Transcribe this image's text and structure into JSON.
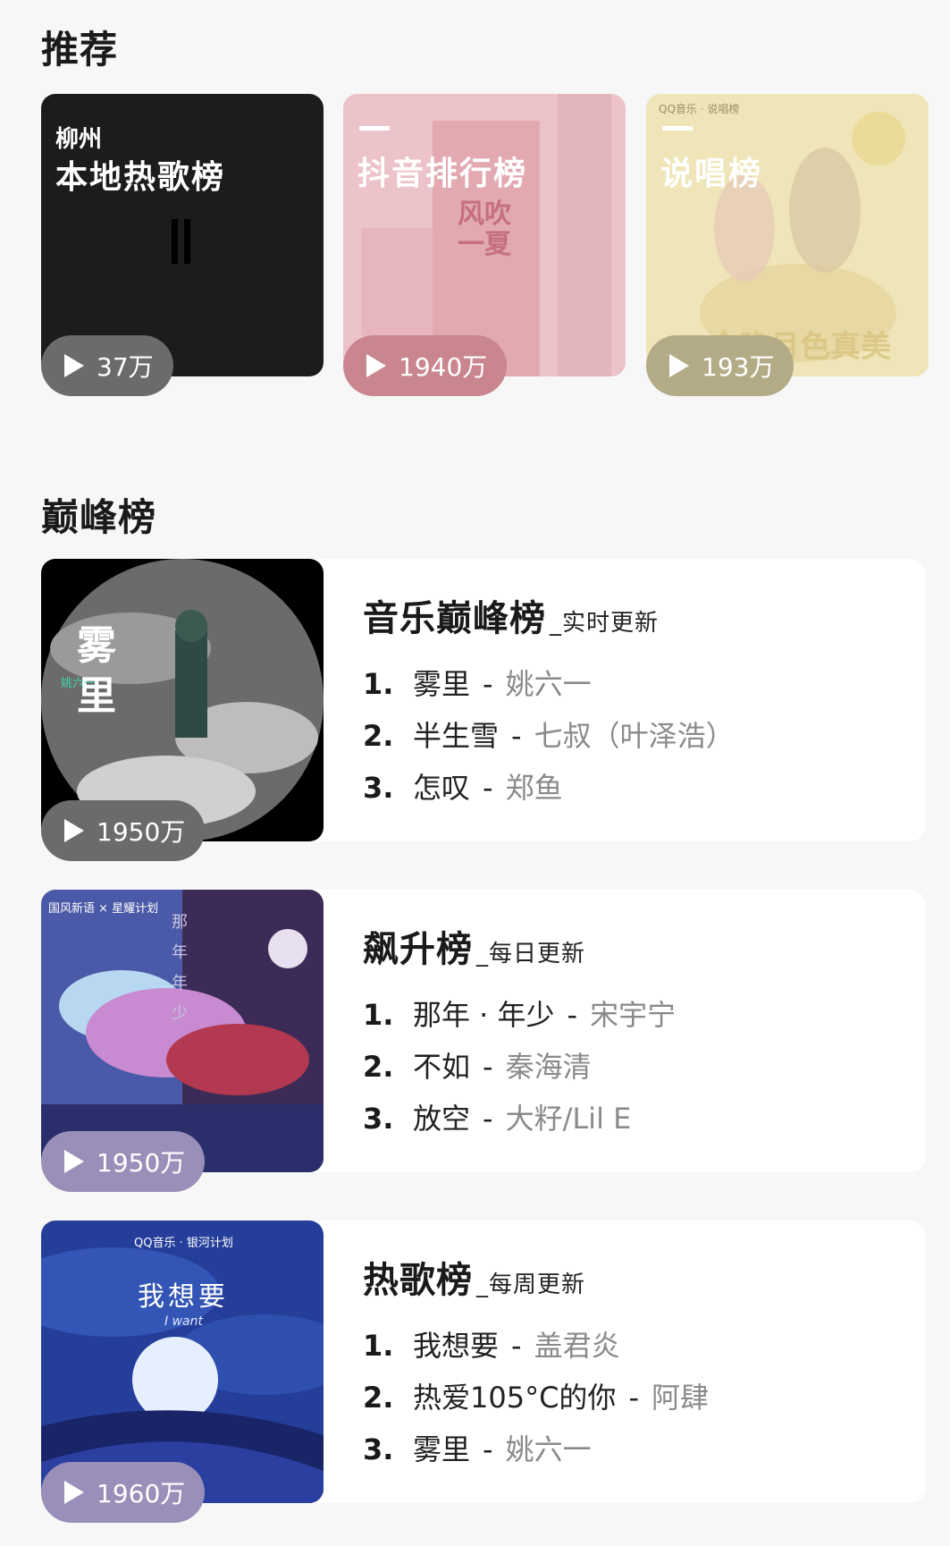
{
  "recommend": {
    "title": "推荐",
    "cards": [
      {
        "subtitle": "柳州",
        "title": "本地热歌榜",
        "plays": "37万"
      },
      {
        "title": "抖音排行榜",
        "plays": "1940万"
      },
      {
        "title": "说唱榜",
        "plays": "193万"
      }
    ]
  },
  "peak": {
    "title": "巅峰榜",
    "charts": [
      {
        "name": "音乐巅峰榜",
        "update": "_实时更新",
        "plays": "1950万",
        "songs": [
          {
            "no": "1.",
            "title": "雾里",
            "artist": "姚六一"
          },
          {
            "no": "2.",
            "title": "半生雪",
            "artist": "七叔（叶泽浩）"
          },
          {
            "no": "3.",
            "title": "怎叹",
            "artist": "郑鱼"
          }
        ]
      },
      {
        "name": "飙升榜",
        "update": "_每日更新",
        "plays": "1950万",
        "songs": [
          {
            "no": "1.",
            "title": "那年 · 年少",
            "artist": "宋宇宁"
          },
          {
            "no": "2.",
            "title": "不如",
            "artist": "秦海清"
          },
          {
            "no": "3.",
            "title": "放空",
            "artist": "大籽/Lil E"
          }
        ]
      },
      {
        "name": "热歌榜",
        "update": "_每周更新",
        "plays": "1960万",
        "songs": [
          {
            "no": "1.",
            "title": "我想要",
            "artist": "盖君炎"
          },
          {
            "no": "2.",
            "title": "热爱105°C的你",
            "artist": "阿肆"
          },
          {
            "no": "3.",
            "title": "雾里",
            "artist": "姚六一"
          }
        ]
      }
    ]
  },
  "cover_text": {
    "wuli": "雾里",
    "wuli_artist": "姚六一",
    "nanian_brand": "国风新语 × 星耀计划",
    "nanian_vertical": "那年年少",
    "woxiangyao_brand": "QQ音乐 · 银河计划",
    "woxiangyao_title": "我想要",
    "woxiangyao_en": "I want",
    "douyin_poster": "风吹一夏",
    "rap_brand": "QQ音乐 · 说唱榜",
    "rap_overlay": "今晚月色真美"
  },
  "colors": {
    "pill_dark": "#6b6b6b",
    "pill_pink": "#c9868f",
    "pill_khaki": "#b3ab86",
    "pill_lavender": "#9a8fb8"
  }
}
